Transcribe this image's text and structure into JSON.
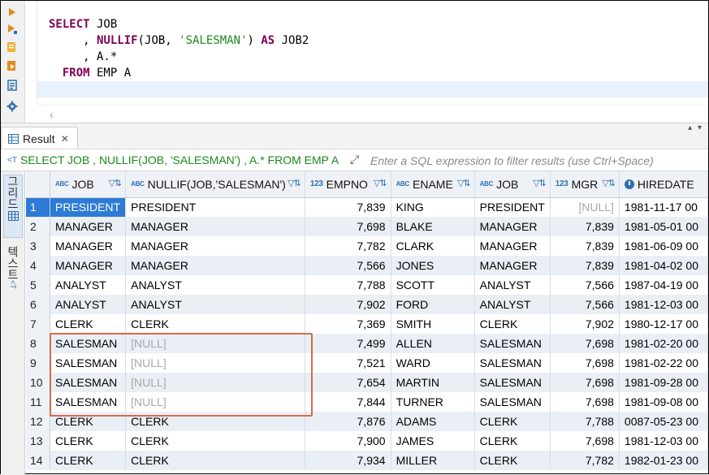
{
  "editor": {
    "lines": [
      [
        {
          "t": "SELECT",
          "c": "kw"
        },
        {
          "t": " JOB",
          "c": "plain"
        }
      ],
      [
        {
          "t": "     , ",
          "c": "plain"
        },
        {
          "t": "NULLIF",
          "c": "kw"
        },
        {
          "t": "(JOB, ",
          "c": "plain"
        },
        {
          "t": "'SALESMAN'",
          "c": "str"
        },
        {
          "t": ") ",
          "c": "plain"
        },
        {
          "t": "AS",
          "c": "kw"
        },
        {
          "t": " JOB2",
          "c": "plain"
        }
      ],
      [
        {
          "t": "     , A.*",
          "c": "plain"
        }
      ],
      [
        {
          "t": "  ",
          "c": "plain"
        },
        {
          "t": "FROM",
          "c": "kw"
        },
        {
          "t": " EMP A",
          "c": "plain"
        }
      ]
    ]
  },
  "result_tab": {
    "label": "Result"
  },
  "filter": {
    "query": "SELECT JOB , NULLIF(JOB, 'SALESMAN') , A.* FROM EMP A",
    "placeholder": "Enter a SQL expression to filter results (use Ctrl+Space)"
  },
  "side_panel": {
    "grid_label": "그리드",
    "text_label": "텍스트"
  },
  "grid": {
    "columns": [
      {
        "name": "JOB",
        "type": "ABC"
      },
      {
        "name": "NULLIF(JOB,'SALESMAN')",
        "type": "ABC"
      },
      {
        "name": "EMPNO",
        "type": "123"
      },
      {
        "name": "ENAME",
        "type": "ABC"
      },
      {
        "name": "JOB",
        "type": "ABC"
      },
      {
        "name": "MGR",
        "type": "123"
      },
      {
        "name": "HIREDATE",
        "type": "date"
      }
    ],
    "rows": [
      {
        "n": "1",
        "cells": [
          "PRESIDENT",
          "PRESIDENT",
          "7,839",
          "KING",
          "PRESIDENT",
          "[NULL]",
          "1981-11-17 00"
        ]
      },
      {
        "n": "2",
        "cells": [
          "MANAGER",
          "MANAGER",
          "7,698",
          "BLAKE",
          "MANAGER",
          "7,839",
          "1981-05-01 00"
        ]
      },
      {
        "n": "3",
        "cells": [
          "MANAGER",
          "MANAGER",
          "7,782",
          "CLARK",
          "MANAGER",
          "7,839",
          "1981-06-09 00"
        ]
      },
      {
        "n": "4",
        "cells": [
          "MANAGER",
          "MANAGER",
          "7,566",
          "JONES",
          "MANAGER",
          "7,839",
          "1981-04-02 00"
        ]
      },
      {
        "n": "5",
        "cells": [
          "ANALYST",
          "ANALYST",
          "7,788",
          "SCOTT",
          "ANALYST",
          "7,566",
          "1987-04-19 00"
        ]
      },
      {
        "n": "6",
        "cells": [
          "ANALYST",
          "ANALYST",
          "7,902",
          "FORD",
          "ANALYST",
          "7,566",
          "1981-12-03 00"
        ]
      },
      {
        "n": "7",
        "cells": [
          "CLERK",
          "CLERK",
          "7,369",
          "SMITH",
          "CLERK",
          "7,902",
          "1980-12-17 00"
        ]
      },
      {
        "n": "8",
        "cells": [
          "SALESMAN",
          "[NULL]",
          "7,499",
          "ALLEN",
          "SALESMAN",
          "7,698",
          "1981-02-20 00"
        ]
      },
      {
        "n": "9",
        "cells": [
          "SALESMAN",
          "[NULL]",
          "7,521",
          "WARD",
          "SALESMAN",
          "7,698",
          "1981-02-22 00"
        ]
      },
      {
        "n": "10",
        "cells": [
          "SALESMAN",
          "[NULL]",
          "7,654",
          "MARTIN",
          "SALESMAN",
          "7,698",
          "1981-09-28 00"
        ]
      },
      {
        "n": "11",
        "cells": [
          "SALESMAN",
          "[NULL]",
          "7,844",
          "TURNER",
          "SALESMAN",
          "7,698",
          "1981-09-08 00"
        ]
      },
      {
        "n": "12",
        "cells": [
          "CLERK",
          "CLERK",
          "7,876",
          "ADAMS",
          "CLERK",
          "7,788",
          "0087-05-23 00"
        ]
      },
      {
        "n": "13",
        "cells": [
          "CLERK",
          "CLERK",
          "7,900",
          "JAMES",
          "CLERK",
          "7,698",
          "1981-12-03 00"
        ]
      },
      {
        "n": "14",
        "cells": [
          "CLERK",
          "CLERK",
          "7,934",
          "MILLER",
          "CLERK",
          "7,782",
          "1982-01-23 00"
        ]
      }
    ],
    "selected": {
      "row": 1,
      "col": 1
    }
  },
  "colors": {
    "accent": "#2d7bd4",
    "highlight_box": "#d96a4a",
    "keyword": "#7f0055",
    "string": "#1a8a1a"
  }
}
